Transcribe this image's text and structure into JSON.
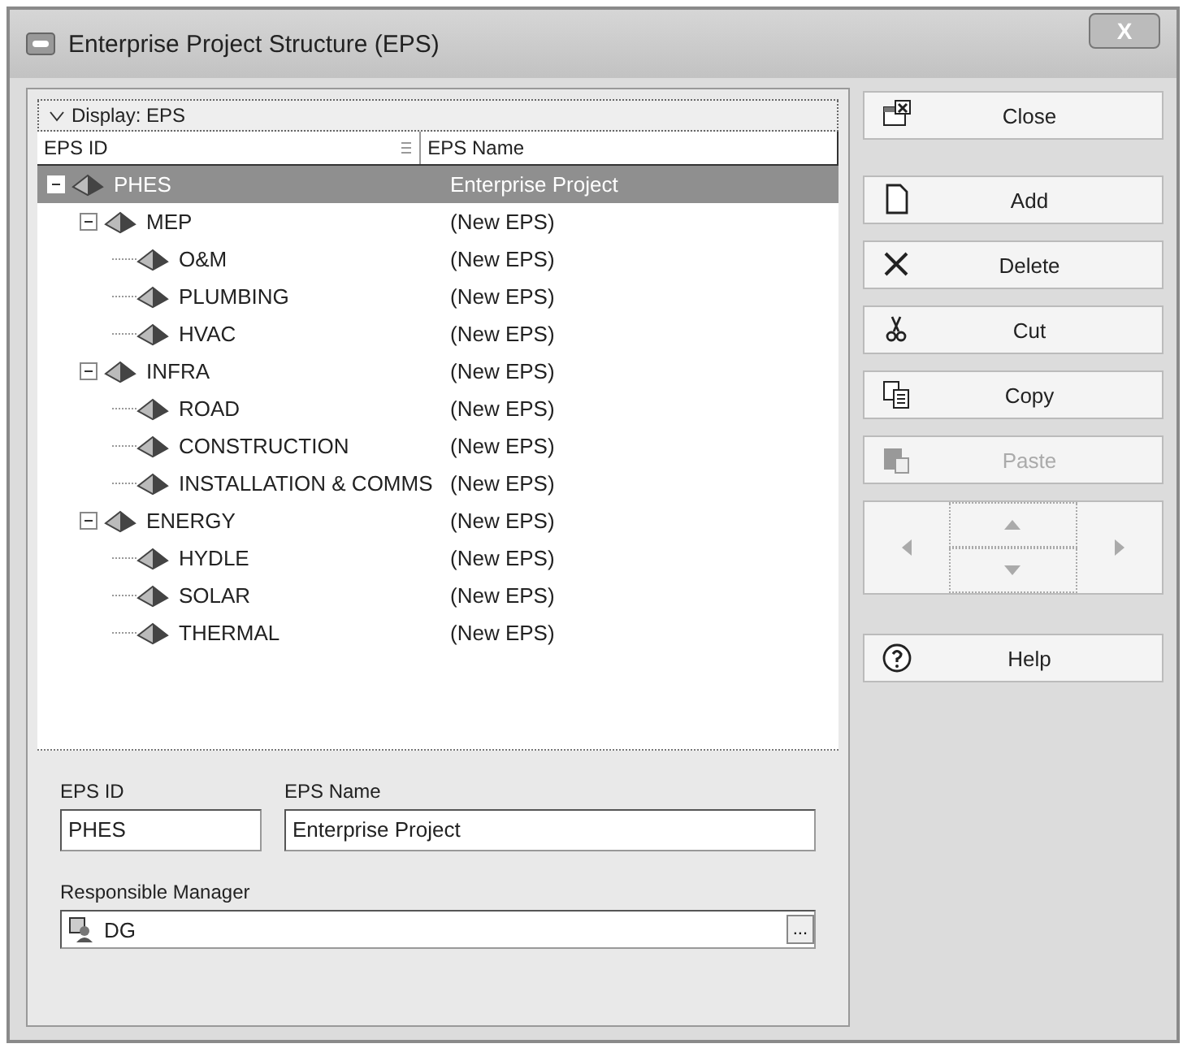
{
  "window": {
    "title": "Enterprise Project Structure (EPS)",
    "close_label": "X"
  },
  "display_bar": {
    "label": "Display: EPS"
  },
  "table": {
    "columns": [
      "EPS ID",
      "EPS Name"
    ],
    "rows": [
      {
        "id": "PHES",
        "name": "Enterprise Project",
        "selected": true,
        "expanded": true,
        "children": [
          {
            "id": "MEP",
            "name": "(New EPS)",
            "selected": false,
            "expanded": true,
            "children": [
              {
                "id": "O&M",
                "name": "(New EPS)",
                "selected": false
              },
              {
                "id": "PLUMBING",
                "name": "(New EPS)",
                "selected": false
              },
              {
                "id": "HVAC",
                "name": "(New EPS)",
                "selected": false
              }
            ]
          },
          {
            "id": "INFRA",
            "name": "(New EPS)",
            "selected": false,
            "expanded": true,
            "children": [
              {
                "id": "ROAD",
                "name": "(New EPS)",
                "selected": false
              },
              {
                "id": "CONSTRUCTION",
                "name": "(New EPS)",
                "selected": false
              },
              {
                "id": "INSTALLATION & COMMS",
                "name": "(New EPS)",
                "selected": false
              }
            ]
          },
          {
            "id": "ENERGY",
            "name": "(New EPS)",
            "selected": false,
            "expanded": true,
            "children": [
              {
                "id": "HYDLE",
                "name": "(New EPS)",
                "selected": false
              },
              {
                "id": "SOLAR",
                "name": "(New EPS)",
                "selected": false
              },
              {
                "id": "THERMAL",
                "name": "(New EPS)",
                "selected": false
              }
            ]
          }
        ]
      }
    ]
  },
  "detail": {
    "eps_id_label": "EPS ID",
    "eps_id": "PHES",
    "eps_name_label": "EPS Name",
    "eps_name": "Enterprise Project",
    "manager_label": "Responsible Manager",
    "manager": "DG",
    "browse_label": "..."
  },
  "buttons": [
    {
      "kind": "close",
      "label": "Close",
      "disabled": false
    },
    {
      "kind": "add",
      "label": "Add",
      "disabled": false
    },
    {
      "kind": "delete",
      "label": "Delete",
      "disabled": false
    },
    {
      "kind": "cut",
      "label": "Cut",
      "disabled": false
    },
    {
      "kind": "copy",
      "label": "Copy",
      "disabled": false
    },
    {
      "kind": "paste",
      "label": "Paste",
      "disabled": true
    },
    {
      "kind": "nav"
    },
    {
      "kind": "help",
      "label": "Help",
      "disabled": false
    }
  ]
}
